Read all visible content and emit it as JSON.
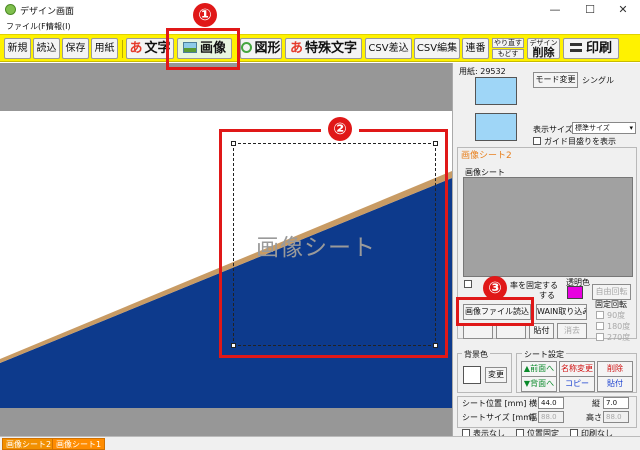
{
  "window": {
    "title": "デザイン画面",
    "min": "—",
    "max": "☐",
    "close": "✕"
  },
  "menu": {
    "file": "ファイル(F)",
    "info": "情報(I)"
  },
  "toolbar": {
    "new": "新規",
    "load": "読込",
    "save": "保存",
    "paper": "用紙",
    "text_glyph": "あ",
    "text": "文字",
    "image": "画像",
    "shape": "図形",
    "special_glyph": "あ",
    "special_text": "特殊文字",
    "csv_insert": "CSV差込",
    "csv_edit": "CSV編集",
    "serial": "連番",
    "redo": "やり直す",
    "undo": "もどす",
    "design": "デザイン",
    "delete": "削除",
    "print": "印刷"
  },
  "annotations": {
    "one": "①",
    "two": "②",
    "three": "③"
  },
  "canvas": {
    "sheet_label": "画像シート",
    "colors": {
      "blue": "#0d3a8c",
      "gold": "#c89b64",
      "gray": "#979797"
    }
  },
  "panel": {
    "paper_label": "用紙: 29532",
    "mode_change": "モード変更",
    "mode_value": "シングル",
    "display_size_label": "表示サイズ",
    "display_size_value": "標準サイズ",
    "guide_label": "ガイド目盛りを表示",
    "sheet_title": "画像シート2",
    "preview_label": "画像シート",
    "fix_ratio_label": "率を固定する",
    "fit_label": "する",
    "transparent_label": "透明色",
    "transparent_color": "#e800e0",
    "free_rotate": "自由回転",
    "load_image": "画像ファイル読込",
    "wain_import": "WAIN取り込み",
    "fixed_rotate_label": "固定回転",
    "rot_90": "90度",
    "rot_180": "180度",
    "rot_270": "270度",
    "paste": "貼付",
    "erase": "消去",
    "bg_color_label": "背景色",
    "bg_change": "変更",
    "sheet_settings_label": "シート設定",
    "front": "▲前面へ",
    "back": "▼背面へ",
    "rename": "名称変更",
    "copy": "コピー",
    "delete": "削除",
    "paste2": "貼付",
    "position_label": "シート位置 [mm]",
    "x_label": "横",
    "x_value": "44.0",
    "y_label": "縦",
    "y_value": "7.0",
    "size_label": "シートサイズ [mm]",
    "w_label": "幅",
    "w_value": "88.0",
    "h_label": "高さ",
    "h_value": "88.0",
    "hide_label": "表示なし",
    "pos_fixed_label": "位置固定",
    "no_print_label": "印刷なし"
  },
  "tabs": {
    "sheet2": "画像シート2",
    "sheet1": "画像シート1"
  }
}
